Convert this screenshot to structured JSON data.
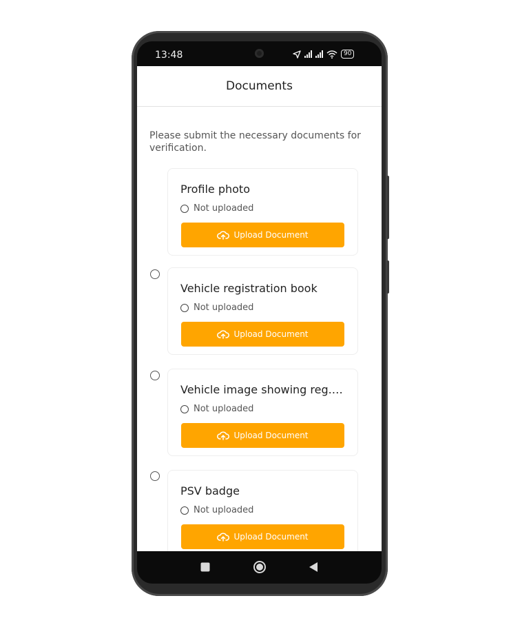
{
  "status_bar": {
    "time": "13:48",
    "battery": "90",
    "icons": [
      "location-icon",
      "signal-icon",
      "signal-icon",
      "wifi-icon",
      "battery-icon"
    ]
  },
  "header": {
    "title": "Documents"
  },
  "instructions": "Please submit the necessary documents for verification.",
  "documents": [
    {
      "title": "Profile photo",
      "status": "Not uploaded",
      "button": "Upload Document"
    },
    {
      "title": "Vehicle registration book",
      "status": "Not uploaded",
      "button": "Upload Document"
    },
    {
      "title": "Vehicle image showing reg.n...",
      "status": "Not uploaded",
      "button": "Upload Document"
    },
    {
      "title": "PSV badge",
      "status": "Not uploaded",
      "button": "Upload Document"
    }
  ],
  "nav_bar": {
    "icons": [
      "recents-icon",
      "home-icon",
      "back-icon"
    ]
  },
  "colors": {
    "accent": "#FFA500",
    "text": "#222222",
    "muted": "#555555"
  }
}
